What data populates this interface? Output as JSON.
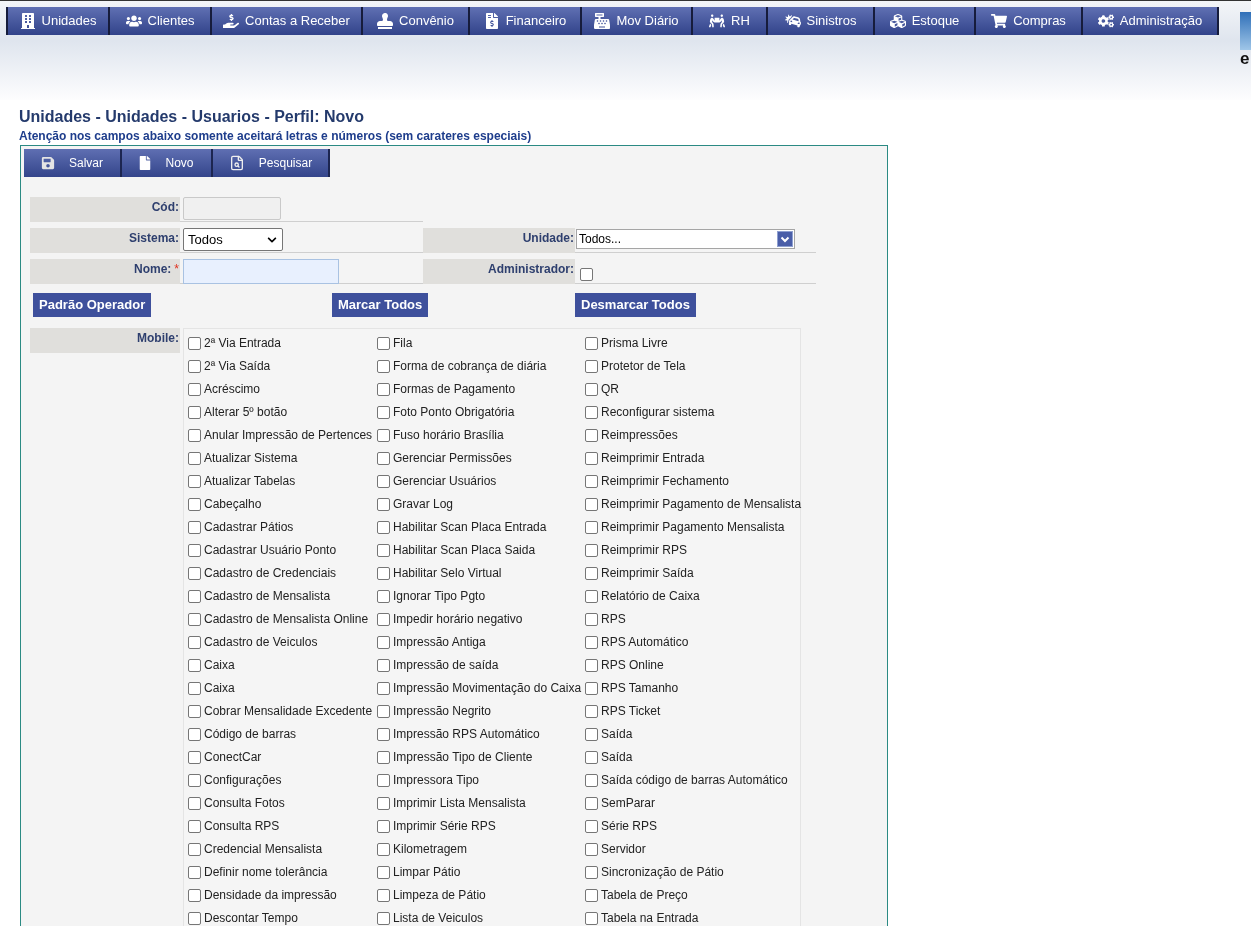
{
  "nav_menu": [
    "Unidades",
    "Clientes",
    "Contas a Receber",
    "Convênio",
    "Financeiro",
    "Mov Diário",
    "RH",
    "Sinistros",
    "Estoque",
    "Compras",
    "Administração"
  ],
  "logo": {
    "text": "e"
  },
  "page_title": "Unidades - Unidades - Usuarios - Perfil: Novo",
  "notice": "Atenção nos campos abaixo somente aceitará letras e números (sem carateres especiais)",
  "toolbar": [
    "Salvar",
    "Novo",
    "Pesquisar"
  ],
  "form": {
    "cod": {
      "label": "Cód:",
      "disabled": true
    },
    "sistema": {
      "label": "Sistema:",
      "value": "Todos"
    },
    "unidade": {
      "label": "Unidade:",
      "value": "Todos..."
    },
    "nome": {
      "label": "Nome:",
      "required_mark": "*"
    },
    "administrador": {
      "label": "Administrador:",
      "checked": false
    }
  },
  "action_buttons": [
    "Padrão Operador",
    "Marcar Todos",
    "Desmarcar Todos"
  ],
  "permissions": {
    "label": "Mobile:",
    "columns": [
      {
        "items": [
          {
            "label": "2ª Via Entrada",
            "checked": false
          },
          {
            "label": "2ª Via Saída",
            "checked": false
          },
          {
            "label": "Acréscimo",
            "checked": false
          },
          {
            "label": "Alterar 5º botão",
            "checked": false
          },
          {
            "label": "Anular Impressão de Pertences",
            "checked": false
          },
          {
            "label": "Atualizar Sistema",
            "checked": false
          },
          {
            "label": "Atualizar Tabelas",
            "checked": false
          },
          {
            "label": "Cabeçalho",
            "checked": false
          },
          {
            "label": "Cadastrar Pátios",
            "checked": false
          },
          {
            "label": "Cadastrar Usuário Ponto",
            "checked": false
          },
          {
            "label": "Cadastro de Credenciais",
            "checked": false
          },
          {
            "label": "Cadastro de Mensalista",
            "checked": false
          },
          {
            "label": "Cadastro de Mensalista Online",
            "checked": false
          },
          {
            "label": "Cadastro de Veiculos",
            "checked": false
          },
          {
            "label": "Caixa",
            "checked": false
          },
          {
            "label": "Caixa",
            "checked": false
          },
          {
            "label": "Cobrar Mensalidade Excedente",
            "checked": false
          },
          {
            "label": "Código de barras",
            "checked": false
          },
          {
            "label": "ConectCar",
            "checked": false
          },
          {
            "label": "Configurações",
            "checked": false
          },
          {
            "label": "Consulta Fotos",
            "checked": false
          },
          {
            "label": "Consulta RPS",
            "checked": false
          },
          {
            "label": "Credencial Mensalista",
            "checked": false
          },
          {
            "label": "Definir nome tolerância",
            "checked": false
          },
          {
            "label": "Densidade da impressão",
            "checked": false
          },
          {
            "label": "Descontar Tempo",
            "checked": false
          }
        ]
      },
      {
        "items": [
          {
            "label": "Fila",
            "checked": false
          },
          {
            "label": "Forma de cobrança de diária",
            "checked": false
          },
          {
            "label": "Formas de Pagamento",
            "checked": false
          },
          {
            "label": "Foto Ponto Obrigatória",
            "checked": false
          },
          {
            "label": "Fuso horário Brasília",
            "checked": false
          },
          {
            "label": "Gerenciar Permissões",
            "checked": false
          },
          {
            "label": "Gerenciar Usuários",
            "checked": false
          },
          {
            "label": "Gravar Log",
            "checked": false
          },
          {
            "label": "Habilitar Scan Placa Entrada",
            "checked": false
          },
          {
            "label": "Habilitar Scan Placa Saida",
            "checked": false
          },
          {
            "label": "Habilitar Selo Virtual",
            "checked": false
          },
          {
            "label": "Ignorar Tipo Pgto",
            "checked": false
          },
          {
            "label": "Impedir horário negativo",
            "checked": false
          },
          {
            "label": "Impressão Antiga",
            "checked": false
          },
          {
            "label": "Impressão de saída",
            "checked": false
          },
          {
            "label": "Impressão Movimentação do Caixa",
            "checked": false
          },
          {
            "label": "Impressão Negrito",
            "checked": false
          },
          {
            "label": "Impressão RPS Automático",
            "checked": false
          },
          {
            "label": "Impressão Tipo de Cliente",
            "checked": false
          },
          {
            "label": "Impressora Tipo",
            "checked": false
          },
          {
            "label": "Imprimir Lista Mensalista",
            "checked": false
          },
          {
            "label": "Imprimir Série RPS",
            "checked": false
          },
          {
            "label": "Kilometragem",
            "checked": false
          },
          {
            "label": "Limpar Pátio",
            "checked": false
          },
          {
            "label": "Limpeza de Pátio",
            "checked": false
          },
          {
            "label": "Lista de Veiculos",
            "checked": false
          }
        ]
      },
      {
        "items": [
          {
            "label": "Prisma Livre",
            "checked": false
          },
          {
            "label": "Protetor de Tela",
            "checked": false
          },
          {
            "label": "QR",
            "checked": false
          },
          {
            "label": "Reconfigurar sistema",
            "checked": false
          },
          {
            "label": "Reimpressões",
            "checked": false
          },
          {
            "label": "Reimprimir Entrada",
            "checked": false
          },
          {
            "label": "Reimprimir Fechamento",
            "checked": false
          },
          {
            "label": "Reimprimir Pagamento de Mensalista",
            "checked": false
          },
          {
            "label": "Reimprimir Pagamento Mensalista",
            "checked": false
          },
          {
            "label": "Reimprimir RPS",
            "checked": false
          },
          {
            "label": "Reimprimir Saída",
            "checked": false
          },
          {
            "label": "Relatório de Caixa",
            "checked": false
          },
          {
            "label": "RPS",
            "checked": false
          },
          {
            "label": "RPS Automático",
            "checked": false
          },
          {
            "label": "RPS Online",
            "checked": false
          },
          {
            "label": "RPS Tamanho",
            "checked": false
          },
          {
            "label": "RPS Ticket",
            "checked": false
          },
          {
            "label": "Saída",
            "checked": false
          },
          {
            "label": "Saída",
            "checked": false
          },
          {
            "label": "Saída código de barras Automático",
            "checked": false
          },
          {
            "label": "SemParar",
            "checked": false
          },
          {
            "label": "Série RPS",
            "checked": false
          },
          {
            "label": "Servidor",
            "checked": false
          },
          {
            "label": "Sincronização de Pátio",
            "checked": false
          },
          {
            "label": "Tabela de Preço",
            "checked": false
          },
          {
            "label": "Tabela na Entrada",
            "checked": false
          }
        ]
      }
    ]
  }
}
